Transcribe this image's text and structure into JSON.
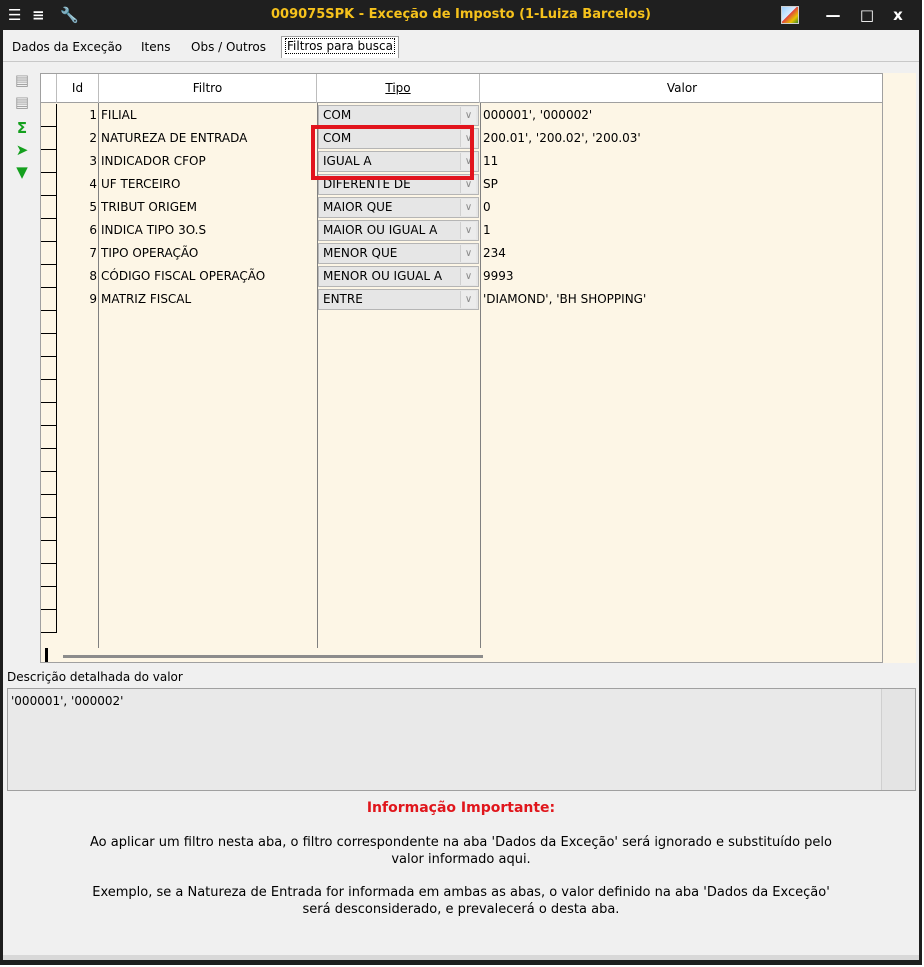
{
  "window": {
    "title": "009075SPK - Exceção de Imposto (1-Luiza Barcelos)",
    "minimize": "—",
    "maximize": "□",
    "close": "x"
  },
  "tabs": [
    {
      "label": "Dados da Exceção",
      "active": false
    },
    {
      "label": "Itens",
      "active": false
    },
    {
      "label": "Obs / Outros",
      "active": false
    },
    {
      "label": "Filtros para busca",
      "active": true
    }
  ],
  "left_tools": [
    "add-row-icon",
    "remove-row-icon",
    "sum-icon",
    "export-icon",
    "collapse-icon"
  ],
  "grid": {
    "headers": {
      "id": "Id",
      "filtro": "Filtro",
      "tipo": "Tipo",
      "valor": "Valor"
    },
    "rows": [
      {
        "id": "1",
        "filtro": "FILIAL",
        "tipo": "COM",
        "valor": "000001', '000002'"
      },
      {
        "id": "2",
        "filtro": "NATUREZA DE ENTRADA",
        "tipo": "COM",
        "valor": "200.01', '200.02', '200.03'"
      },
      {
        "id": "3",
        "filtro": "INDICADOR CFOP",
        "tipo": "IGUAL A",
        "valor": "11"
      },
      {
        "id": "4",
        "filtro": "UF TERCEIRO",
        "tipo": "DIFERENTE DE",
        "valor": "SP"
      },
      {
        "id": "5",
        "filtro": "TRIBUT ORIGEM",
        "tipo": "MAIOR QUE",
        "valor": "0"
      },
      {
        "id": "6",
        "filtro": "INDICA TIPO 3O.S",
        "tipo": "MAIOR OU IGUAL A",
        "valor": "1"
      },
      {
        "id": "7",
        "filtro": "TIPO OPERAÇÃO",
        "tipo": "MENOR QUE",
        "valor": "234"
      },
      {
        "id": "8",
        "filtro": "CÓDIGO FISCAL OPERAÇÃO",
        "tipo": "MENOR OU IGUAL A",
        "valor": "9993"
      },
      {
        "id": "9",
        "filtro": "MATRIZ FISCAL",
        "tipo": "ENTRE",
        "valor": "'DIAMOND', 'BH SHOPPING'"
      }
    ],
    "highlight_color": "#e2141d",
    "row_background": "#fdf6e6"
  },
  "description": {
    "label": "Descrição detalhada do valor",
    "value": "'000001', '000002'"
  },
  "info": {
    "title": "Informação Importante:",
    "p1_line1": "Ao aplicar um filtro nesta aba, o filtro correspondente na aba 'Dados da Exceção' será ignorado e substituído pelo",
    "p1_line2": "valor informado aqui.",
    "p2_line1": "Exemplo, se a Natureza de Entrada for informada em ambas as abas, o valor definido na aba 'Dados da Exceção'",
    "p2_line2": "será desconsiderado, e prevalecerá o desta aba."
  }
}
